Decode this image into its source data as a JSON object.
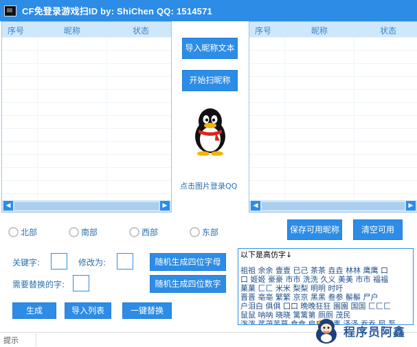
{
  "window": {
    "title": "CF免登录游戏扫ID   by:  ShiChen   QQ:  1514571"
  },
  "left_list": {
    "columns": [
      "序号",
      "昵称",
      "状态"
    ]
  },
  "right_list": {
    "columns": [
      "序号",
      "昵称",
      "状态"
    ]
  },
  "buttons": {
    "import_nickname_text": "导入昵称文本",
    "start_scan": "开始扫昵称",
    "save_available": "保存可用昵称",
    "clear_available": "清空可用",
    "random_four_letters": "随机生成四位字母",
    "random_four_digits": "随机生成四位数字",
    "generate": "生成",
    "import_list": "导入列表",
    "one_click_replace": "一键替换"
  },
  "qq_login": {
    "label": "点击图片登录QQ"
  },
  "regions": [
    {
      "label": "北部",
      "selected": false
    },
    {
      "label": "南部",
      "selected": false
    },
    {
      "label": "西部",
      "selected": false
    },
    {
      "label": "东部",
      "selected": false
    }
  ],
  "fields": {
    "keyword_label": "关键字:",
    "keyword_value": "",
    "modify_to_label": "修改为:",
    "modify_to_value": "",
    "replace_char_label": "需要替换的字:",
    "replace_char_value": ""
  },
  "textarea": {
    "lines": [
      "以下是高仿字↓",
      "祖祖 余余 壹壹 已己 茶茶 垚垚 林林 鹰鹰 口",
      "口 姬姬 豪豪 市市 洗洗 久义 美美 市市 福福",
      "菓菓 匚匚 米米 梨梨 明明 时吁",
      "晋晋 亳亳 繁繁 京京 黑黑 叁参 鬃鬃 尸户",
      "户泪白 俱俱 囗口 晩晚狂狂 園園 国国 匚匚匚",
      "鼠鼠 呐呐 晓晓 篱篱第 厕厕 茂民",
      "泼泼 芪茂芜莫 食食 扁扁 事事 泽泽 吞吞 屈 泵"
    ]
  },
  "statusbar": {
    "hint": "提示"
  },
  "watermark": {
    "text": "程序员阿鑫"
  }
}
